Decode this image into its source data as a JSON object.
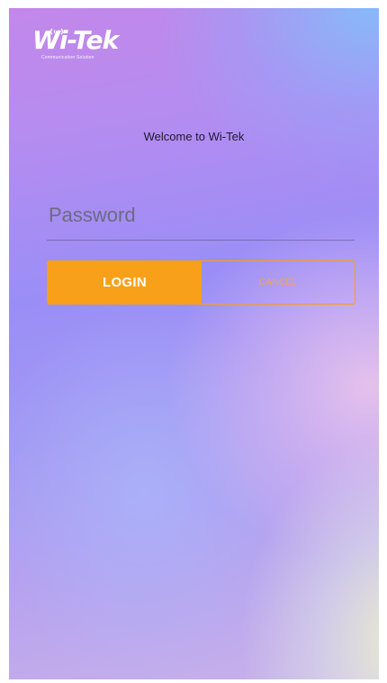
{
  "brand": {
    "logo_text": "Wi-Tek",
    "tagline": "Communication Solution"
  },
  "welcome_text": "Welcome to Wi-Tek",
  "password": {
    "placeholder": "Password",
    "value": ""
  },
  "buttons": {
    "login_label": "LOGIN",
    "cancel_label": "CANCEL"
  },
  "colors": {
    "accent": "#f9a01b",
    "gradient_start": "#c387ea",
    "gradient_mid": "#9a8ef6",
    "gradient_end": "#c8b2ea"
  }
}
